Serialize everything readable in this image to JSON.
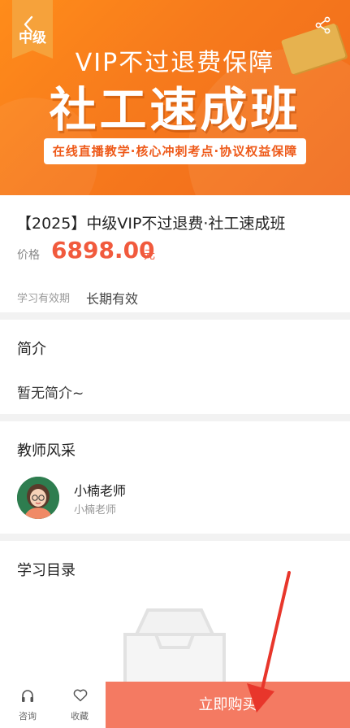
{
  "banner": {
    "badge": "中级",
    "subtitle": "VIP不过退费保障",
    "title": "社工速成班",
    "tagline": "在线直播教学·核心冲刺考点·协议权益保障"
  },
  "course": {
    "title": "【2025】中级VIP不过退费·社工速成班",
    "price_label": "价格",
    "price_value": "6898.00",
    "price_unit": "元",
    "validity_label": "学习有效期",
    "validity_value": "长期有效"
  },
  "intro": {
    "title": "简介",
    "text": "暂无简介~"
  },
  "teacher": {
    "title": "教师风采",
    "name": "小楠老师",
    "subtitle": "小楠老师"
  },
  "catalog": {
    "title": "学习目录"
  },
  "bottom": {
    "consult_label": "咨询",
    "favorite_label": "收藏",
    "buy_label": "立即购买"
  },
  "colors": {
    "accent": "#f15a3d",
    "buy_button": "#f47a62",
    "banner": "#f77b1c"
  },
  "icons": [
    "back-icon",
    "share-icon",
    "headset-icon",
    "heart-icon",
    "empty-box-icon"
  ]
}
